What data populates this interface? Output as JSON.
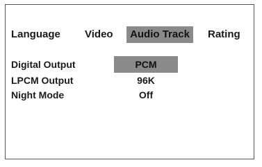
{
  "tabs": [
    {
      "label": "Language",
      "selected": false
    },
    {
      "label": "Video",
      "selected": false
    },
    {
      "label": "Audio Track",
      "selected": true
    },
    {
      "label": "Rating",
      "selected": false
    }
  ],
  "settings": [
    {
      "label": "Digital Output",
      "value": "PCM",
      "highlighted": true
    },
    {
      "label": "LPCM Output",
      "value": "96K",
      "highlighted": false
    },
    {
      "label": "Night Mode",
      "value": "Off",
      "highlighted": false
    }
  ],
  "colors": {
    "highlight": "#8a8a8a",
    "border": "#555555",
    "text": "#1a1a1a",
    "background": "#ffffff"
  }
}
